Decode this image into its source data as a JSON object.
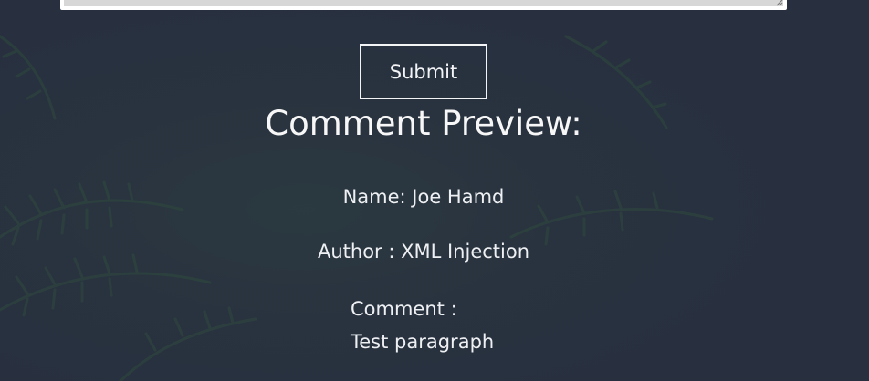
{
  "form": {
    "submit_label": "Submit"
  },
  "preview": {
    "title": "Comment Preview:",
    "name_line": "Name: Joe Hamd",
    "author_line": "Author : XML Injection",
    "comment_label": "Comment :",
    "comment_text": "Test paragraph"
  },
  "colors": {
    "background": "#28303f",
    "foliage": "#2f4a3e",
    "text": "#f3f4f6",
    "textarea_fill": "#d7d7d7"
  }
}
